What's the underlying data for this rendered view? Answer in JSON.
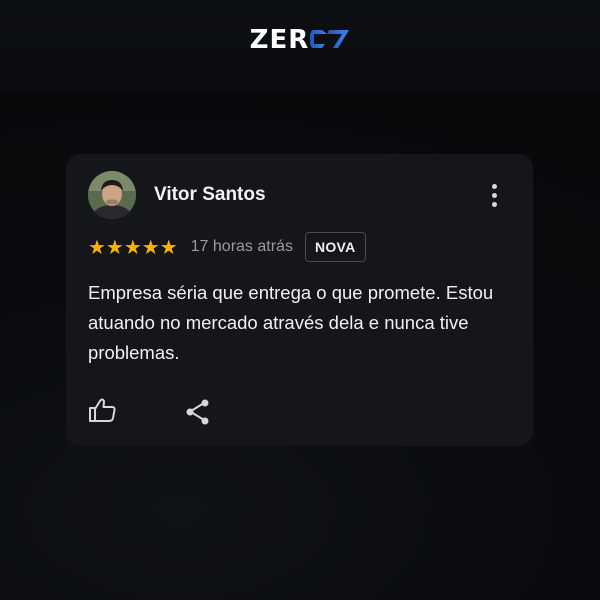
{
  "brand": {
    "logo_text": "ZER",
    "logo_mark_icon": "brand-07-mark-icon",
    "accent": "#2f6fd6"
  },
  "review": {
    "author": "Vitor Santos",
    "rating": 5,
    "stars": "★★★★★",
    "time": "17 horas atrás",
    "badge": "NOVA",
    "text": "Empresa séria que entrega o que promete. Estou atuando no mercado através dela e nunca tive problemas.",
    "star_color": "#f4b400"
  },
  "actions": {
    "like_icon": "thumb-up-icon",
    "share_icon": "share-icon",
    "menu_icon": "more-vertical-icon"
  }
}
